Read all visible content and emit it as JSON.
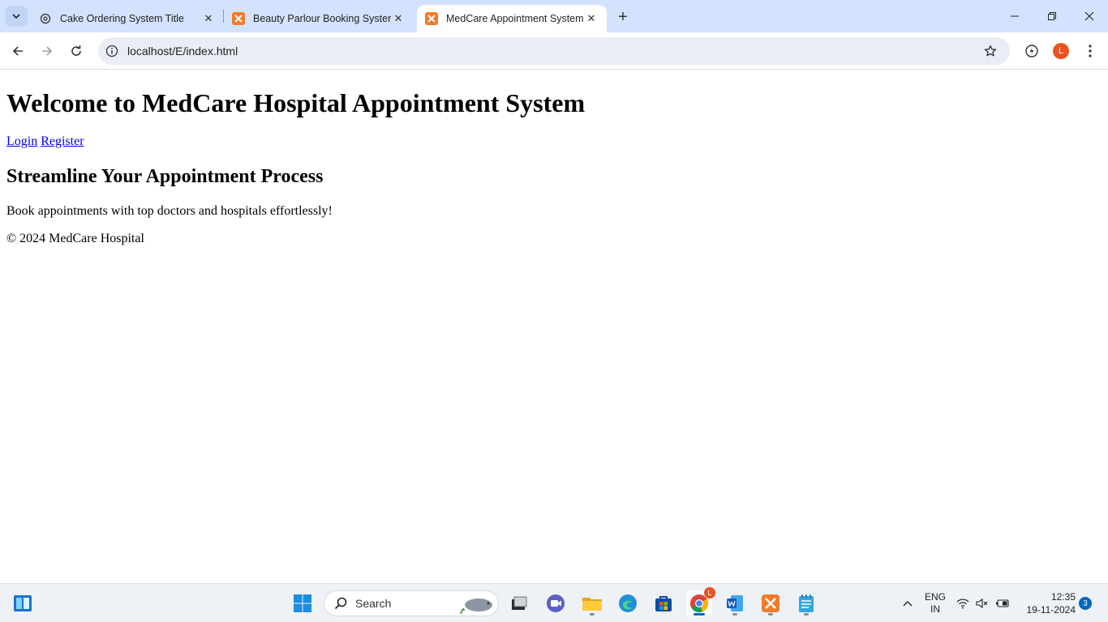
{
  "browser": {
    "tabs": [
      {
        "title": "Cake Ordering System Title",
        "icon": "openai-icon"
      },
      {
        "title": "Beauty Parlour Booking System",
        "icon": "xampp-icon"
      },
      {
        "title": "MedCare Appointment System",
        "icon": "xampp-icon",
        "active": true
      }
    ],
    "url": "localhost/E/index.html",
    "profile_initial": "L",
    "accent_color": "#d3e3fd"
  },
  "page": {
    "heading": "Welcome to MedCare Hospital Appointment System",
    "nav": {
      "login": "Login",
      "register": "Register"
    },
    "subheading": "Streamline Your Appointment Process",
    "lead": "Book appointments with top doctors and hospitals effortlessly!",
    "footer": "© 2024 MedCare Hospital",
    "link_color": "#0000ee"
  },
  "taskbar": {
    "search_label": "Search",
    "chrome_badge": "L",
    "language": {
      "line1": "ENG",
      "line2": "IN"
    },
    "time": "12:35",
    "date": "19-11-2024",
    "notification_count": "3"
  }
}
